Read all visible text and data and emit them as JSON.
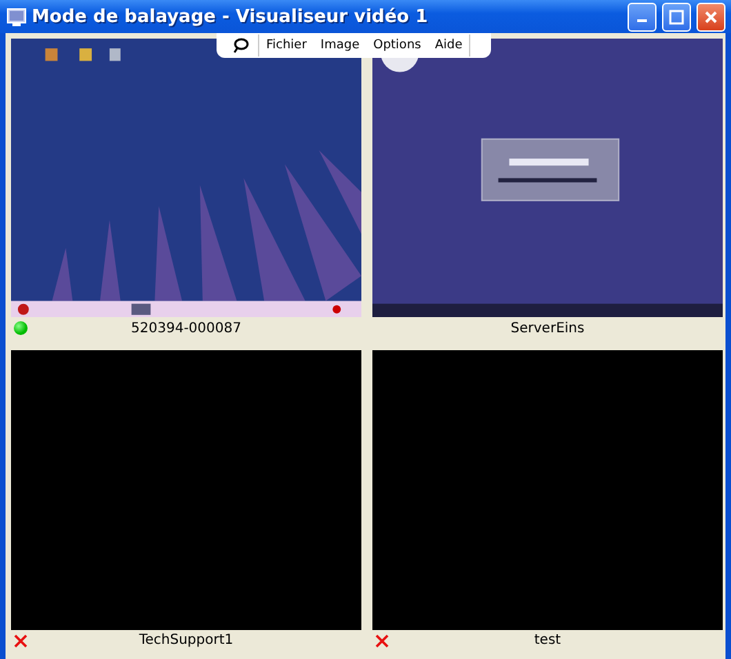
{
  "window": {
    "title": "Mode de balayage - Visualiseur vidéo 1"
  },
  "menu": [
    "Fichier",
    "Image",
    "Options",
    "Aide"
  ],
  "tiles": [
    {
      "name": "520394-000087",
      "connected": true,
      "kind": "picture"
    },
    {
      "name": "ServerEins",
      "kind": "picture"
    },
    {
      "name": "TechSupport1",
      "connected": false,
      "kind": "blank"
    },
    {
      "name": "test",
      "connected": false,
      "kind": "blank"
    }
  ]
}
